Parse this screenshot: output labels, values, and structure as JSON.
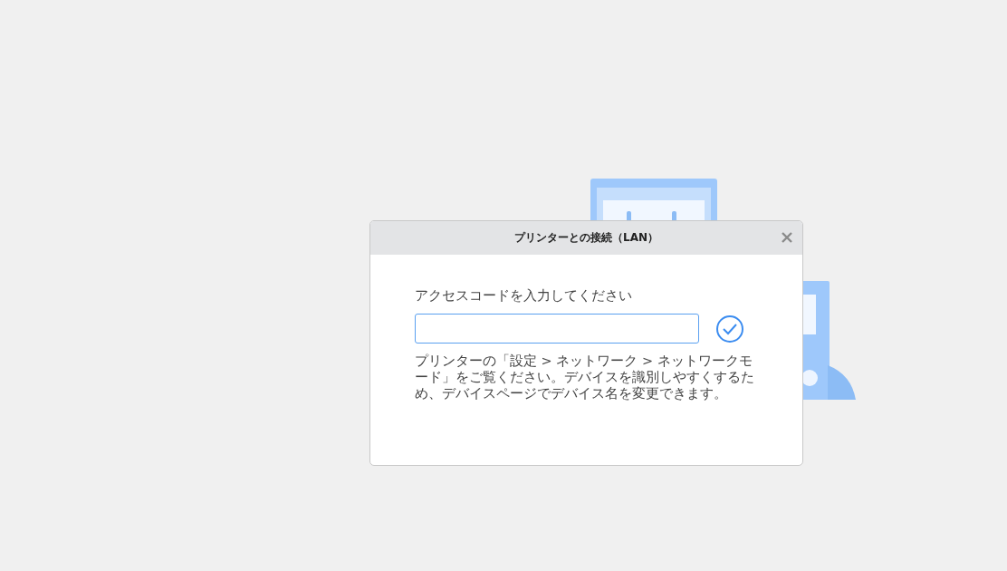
{
  "dialog": {
    "title": "プリンターとの接続（LAN）",
    "prompt": "アクセスコードを入力してください",
    "access_code_field": {
      "focused": true
    },
    "hint": "プリンターの「設定 > ネットワーク > ネットワークモード」をご覧ください。デバイスを識別しやすくするため、デバイスページでデバイス名を変更できます。"
  }
}
